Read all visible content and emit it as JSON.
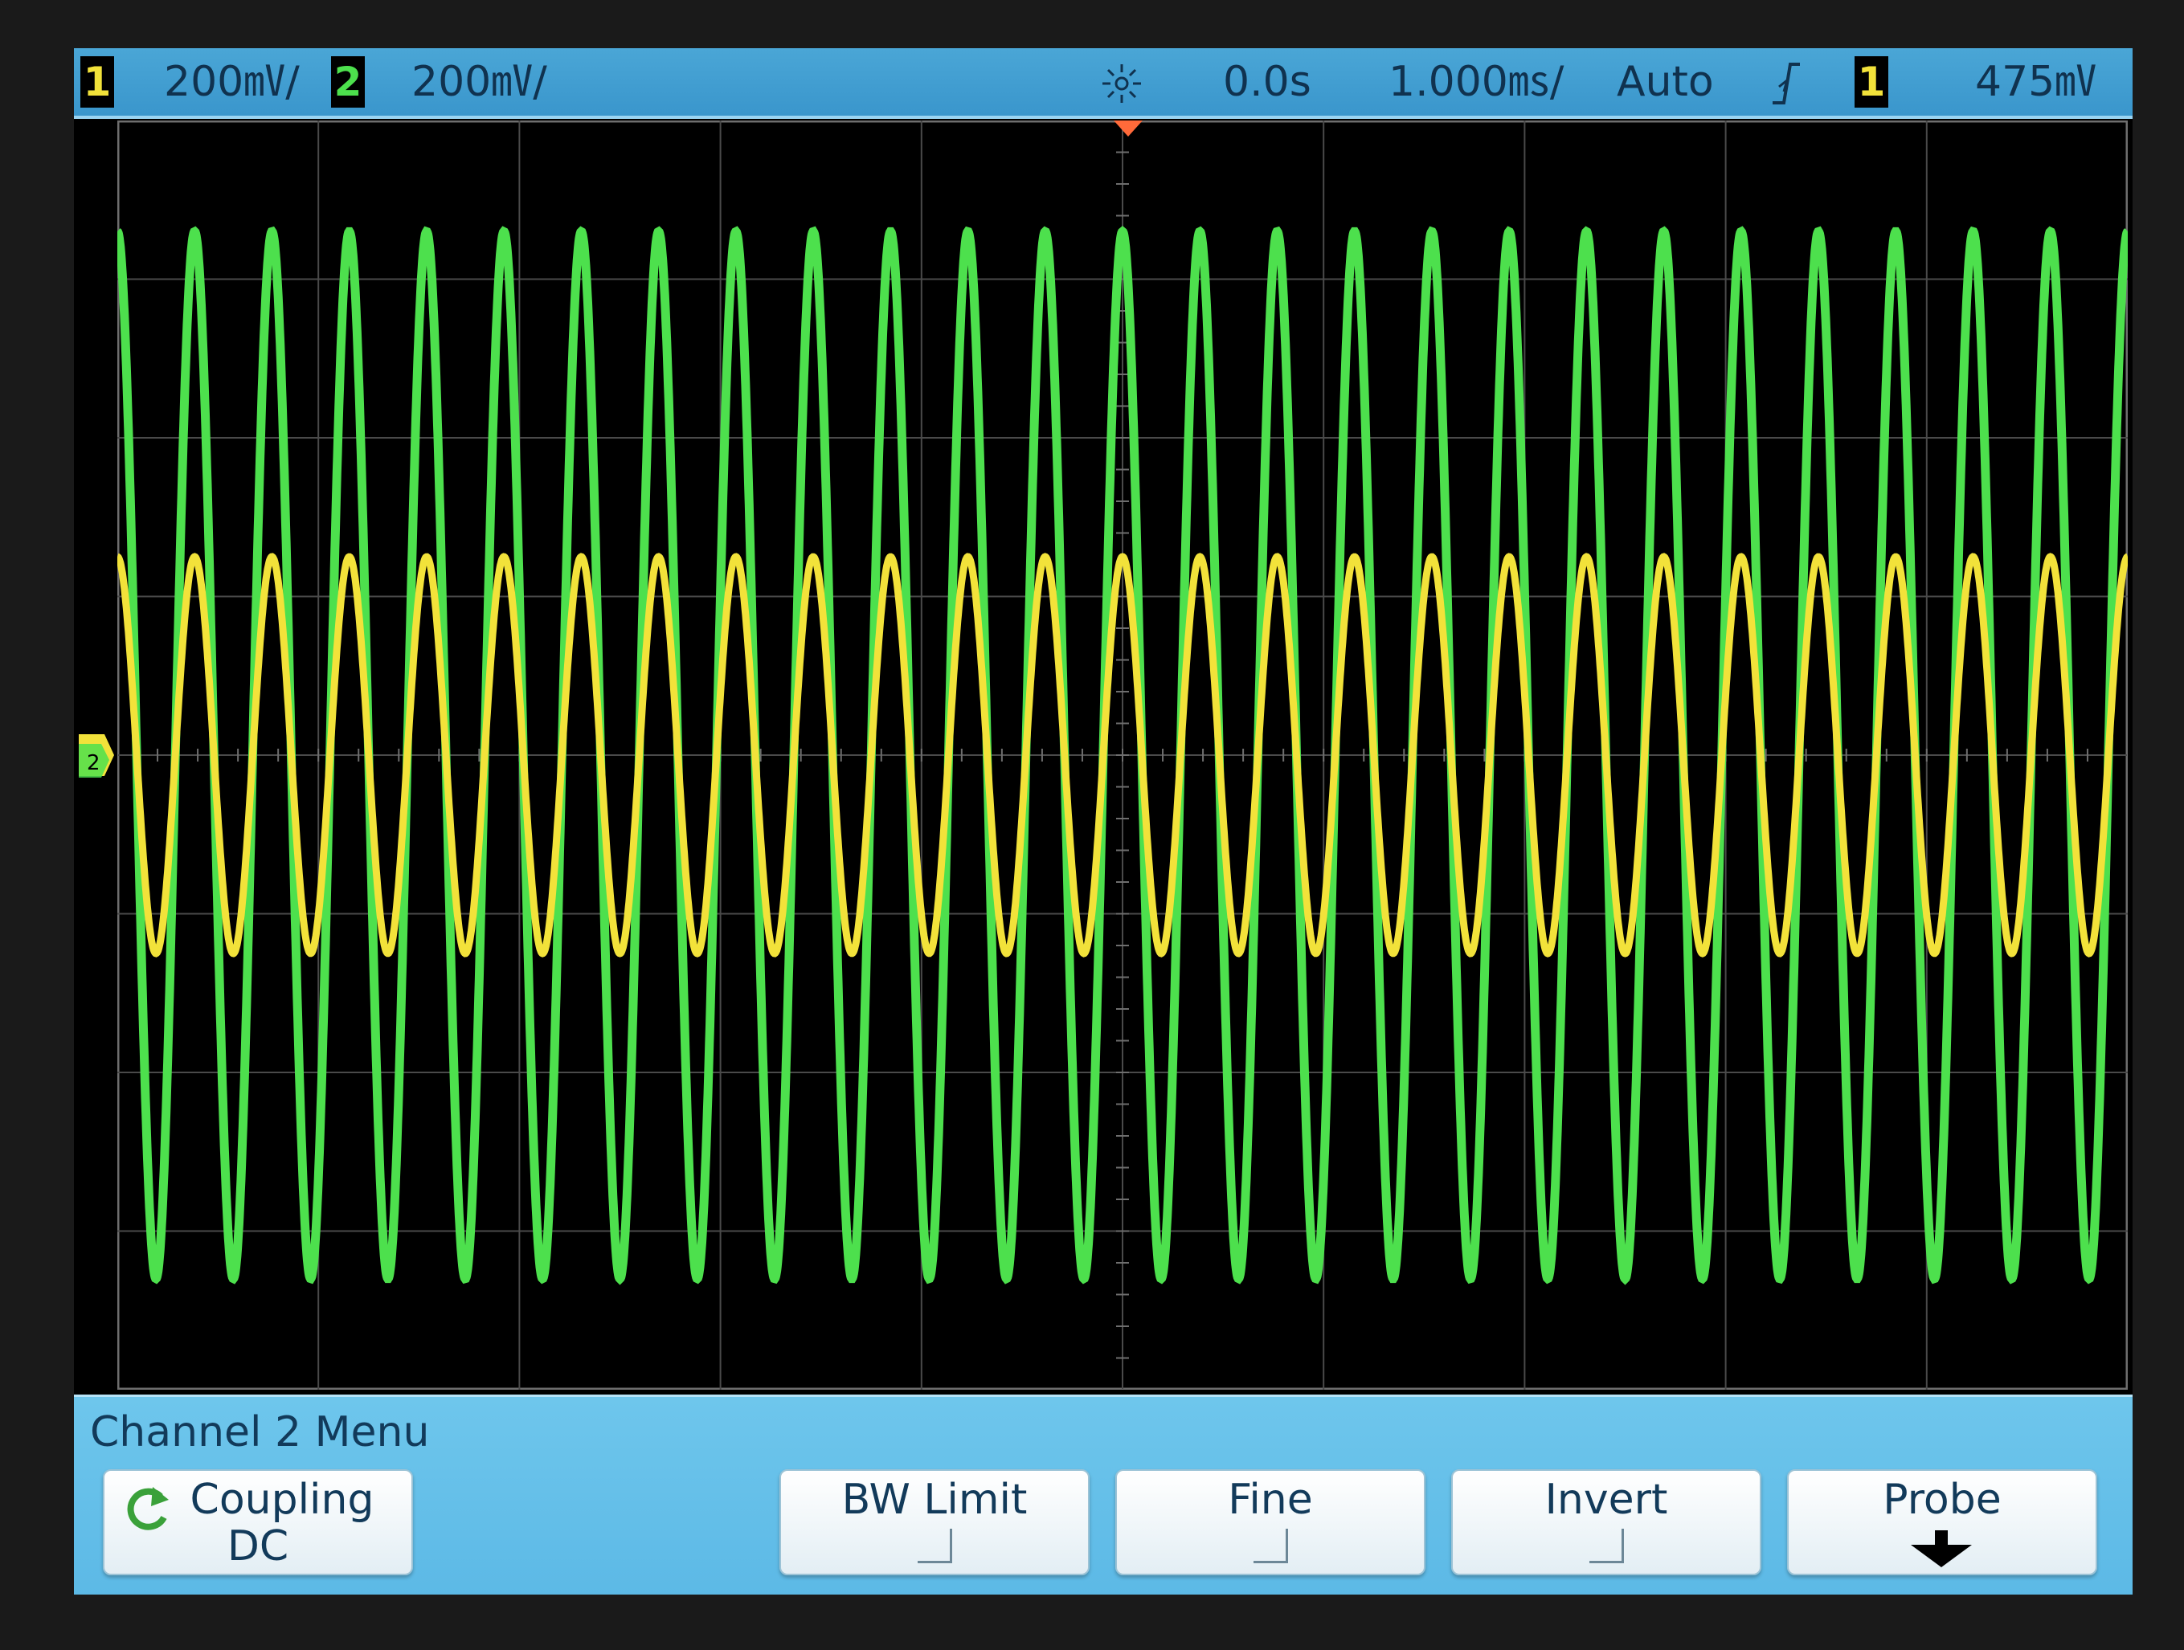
{
  "statusbar": {
    "ch1_badge": "1",
    "ch1_scale": "200㎷/",
    "ch2_badge": "2",
    "ch2_scale": "200㎷/",
    "time_delay": "0.0s",
    "time_scale": "1.000㎳/",
    "trigger_mode": "Auto",
    "trigger_source": "1",
    "trigger_level": "475㎷",
    "icons": [
      "acquire-sun-icon",
      "rising-edge-icon"
    ]
  },
  "colors": {
    "ch1": "#f2e23a",
    "ch2": "#4de04d",
    "bar": "#3a96cc",
    "menu": "#5cb9e6"
  },
  "waveforms": {
    "ch1": {
      "cycles": 26,
      "amplitude_divs": 1.25,
      "offset_divs": 0
    },
    "ch2": {
      "cycles": 26,
      "amplitude_divs": 3.3,
      "offset_divs": 0
    }
  },
  "menu": {
    "title": "Channel 2  Menu",
    "softkeys": [
      {
        "label": "Coupling",
        "value": "DC"
      },
      {
        "label": "BW Limit"
      },
      {
        "label": "Fine"
      },
      {
        "label": "Invert"
      },
      {
        "label": "Probe"
      }
    ]
  }
}
